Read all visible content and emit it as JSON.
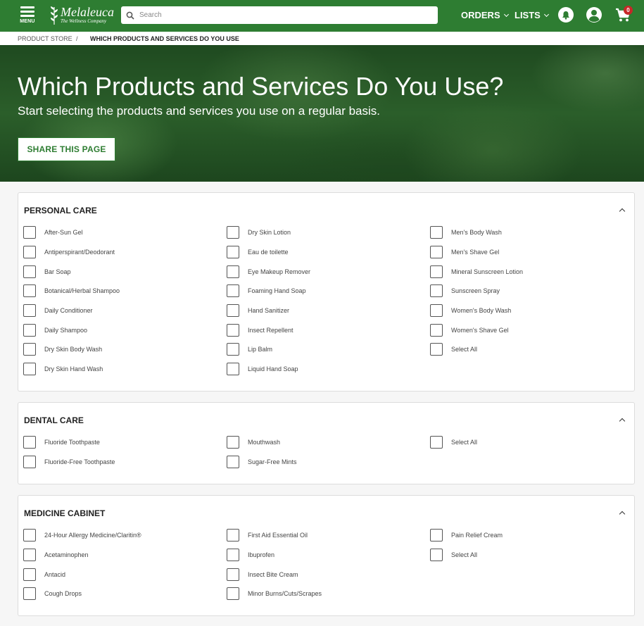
{
  "header": {
    "menu_label": "MENU",
    "logo_name": "Melaleuca",
    "logo_tagline": "The Wellness Company",
    "search_placeholder": "Search",
    "orders_label": "ORDERS",
    "lists_label": "LISTS",
    "cart_count": "0",
    "brand_color": "#2e7d32"
  },
  "breadcrumb": {
    "root": "PRODUCT STORE",
    "separator": "/",
    "current": "WHICH PRODUCTS AND SERVICES DO YOU USE"
  },
  "hero": {
    "title": "Which Products and Services Do You Use?",
    "subtitle": "Start selecting the products and services you use on a regular basis.",
    "share_label": "SHARE THIS PAGE"
  },
  "sections": [
    {
      "title": "PERSONAL CARE",
      "columns": [
        [
          "After-Sun Gel",
          "Antiperspirant/Deodorant",
          "Bar Soap",
          "Botanical/Herbal Shampoo",
          "Daily Conditioner",
          "Daily Shampoo",
          "Dry Skin Body Wash",
          "Dry Skin Hand Wash"
        ],
        [
          "Dry Skin Lotion",
          "Eau de toilette",
          "Eye Makeup Remover",
          "Foaming Hand Soap",
          "Hand Sanitizer",
          "Insect Repellent",
          "Lip Balm",
          "Liquid Hand Soap"
        ],
        [
          "Men's Body Wash",
          "Men's Shave Gel",
          "Mineral Sunscreen Lotion",
          "Sunscreen Spray",
          "Women's Body Wash",
          "Women's Shave Gel",
          "Select All"
        ]
      ]
    },
    {
      "title": "DENTAL CARE",
      "columns": [
        [
          "Fluoride Toothpaste",
          "Fluoride-Free Toothpaste"
        ],
        [
          "Mouthwash",
          "Sugar-Free Mints"
        ],
        [
          "Select All"
        ]
      ]
    },
    {
      "title": "MEDICINE CABINET",
      "columns": [
        [
          "24-Hour Allergy Medicine/Claritin®",
          "Acetaminophen",
          "Antacid",
          "Cough Drops"
        ],
        [
          "First Aid Essential Oil",
          "Ibuprofen",
          "Insect Bite Cream",
          "Minor Burns/Cuts/Scrapes"
        ],
        [
          "Pain Relief Cream",
          "Select All"
        ]
      ]
    }
  ]
}
